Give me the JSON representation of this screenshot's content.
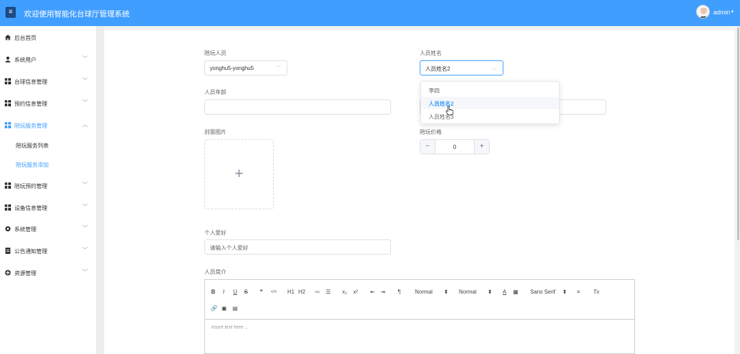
{
  "header": {
    "menu_icon": "hamburger-icon",
    "title": "欢迎使用智能化台球厅管理系统",
    "user": "admin",
    "caret": "▾",
    "accent": "#409eff"
  },
  "sidebar": {
    "items": [
      {
        "label": "后台首页",
        "icon": "home-icon",
        "chevron": ""
      },
      {
        "label": "系统用户",
        "icon": "user-icon",
        "chevron": "﹀"
      },
      {
        "label": "台球信息管理",
        "icon": "grid-icon",
        "chevron": "﹀"
      },
      {
        "label": "预约信息管理",
        "icon": "grid-icon",
        "chevron": "﹀"
      },
      {
        "label": "陪玩服务管理",
        "icon": "grid-icon",
        "chevron": "︿"
      },
      {
        "label": "陪玩预约管理",
        "icon": "grid-icon",
        "chevron": "﹀"
      },
      {
        "label": "设备信息管理",
        "icon": "grid-icon",
        "chevron": "﹀"
      },
      {
        "label": "系统管理",
        "icon": "gear-icon",
        "chevron": "﹀"
      },
      {
        "label": "公告通知管理",
        "icon": "document-icon",
        "chevron": "﹀"
      },
      {
        "label": "资源管理",
        "icon": "plus-circle-icon",
        "chevron": "﹀"
      }
    ],
    "sub_items": [
      {
        "label": "陪玩服务列表"
      },
      {
        "label": "陪玩服务添加"
      }
    ]
  },
  "form": {
    "companion_label": "陪玩人员",
    "companion_value": "yonghu5-yonghu5",
    "staff_name_label": "人员姓名",
    "staff_name_value": "人员姓名2",
    "age_label": "人员年龄",
    "age_value": "",
    "cover_label": "封面图片",
    "upload_symbol": "+",
    "price_label": "陪玩价格",
    "price_value": "0",
    "minus_symbol": "−",
    "plus_symbol": "+",
    "hobby_label": "个人爱好",
    "hobby_placeholder": "请输入个人爱好",
    "intro_label": "人员简介"
  },
  "dropdown": {
    "options": [
      "李四",
      "人员姓名2",
      "人员姓名3"
    ],
    "selected": "人员姓名2"
  },
  "editor": {
    "toolbar_row1": [
      "B",
      "I",
      "U",
      "S",
      "❞",
      "</>",
      "H1",
      "H2",
      "≔",
      "☰",
      "x₂",
      "x²",
      "⇤",
      "⇥",
      "¶",
      "Normal",
      "⬍",
      "Normal",
      "⬍",
      "A",
      "▦",
      "Sans Serif",
      "⬍",
      "≡",
      "Tx"
    ],
    "toolbar_row2": [
      "🔗",
      "▣",
      "▤"
    ],
    "placeholder": "Insert text here ..."
  }
}
